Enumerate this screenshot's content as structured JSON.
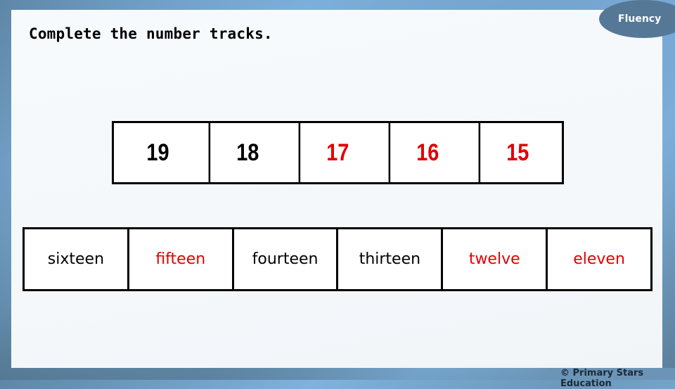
{
  "badge": {
    "label": "Fluency"
  },
  "title": "Complete the number tracks.",
  "number_track": [
    {
      "value": "19",
      "color": "black"
    },
    {
      "value": "18",
      "color": "black"
    },
    {
      "value": "17",
      "color": "red"
    },
    {
      "value": "16",
      "color": "red"
    },
    {
      "value": "15",
      "color": "red"
    }
  ],
  "word_track": [
    {
      "value": "sixteen",
      "color": "black"
    },
    {
      "value": "fifteen",
      "color": "red"
    },
    {
      "value": "fourteen",
      "color": "black"
    },
    {
      "value": "thirteen",
      "color": "black"
    },
    {
      "value": "twelve",
      "color": "red"
    },
    {
      "value": "eleven",
      "color": "red"
    }
  ],
  "footer": "© Primary Stars Education",
  "colors": {
    "answer": "#e00000",
    "given": "#000000",
    "badge": "#557896"
  }
}
